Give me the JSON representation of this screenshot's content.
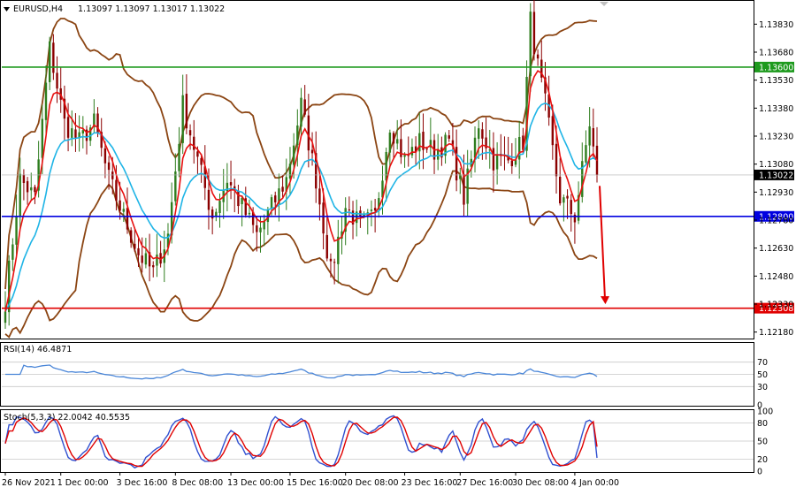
{
  "header": {
    "symbol": "EURUSD,H4",
    "ohlc": "1.13097 1.13097 1.13017 1.13022"
  },
  "colors": {
    "background": "#ffffff",
    "bull": "#2e7d1e",
    "bear": "#8b0000",
    "bollinger": "#8b4513",
    "ma_fast": "#e81010",
    "ma_slow": "#1eb4e6",
    "resistance": "#1e9a1e",
    "support": "#0000e0",
    "target": "#e00000",
    "rsi": "#4a86d8",
    "stoch_main": "#3050d0",
    "stoch_signal": "#e00000"
  },
  "chart_data": [
    {
      "type": "candlestick",
      "symbol": "EURUSD",
      "timeframe": "H4",
      "ylim": [
        1.1215,
        1.1395
      ],
      "y_ticks": [
        "1.13830",
        "1.13680",
        "1.13530",
        "1.13380",
        "1.13230",
        "1.13080",
        "1.12930",
        "1.12780",
        "1.12630",
        "1.12480",
        "1.12330",
        "1.12180"
      ],
      "x_ticks": [
        "26 Nov 2021",
        "1 Dec 00:00",
        "3 Dec 16:00",
        "8 Dec 08:00",
        "13 Dec 00:00",
        "15 Dec 16:00",
        "20 Dec 08:00",
        "23 Dec 16:00",
        "27 Dec 16:00",
        "30 Dec 08:00",
        "4 Jan 00:00"
      ],
      "close_anchors": [
        [
          0,
          1.1235
        ],
        [
          4,
          1.13
        ],
        [
          8,
          1.129
        ],
        [
          12,
          1.137
        ],
        [
          16,
          1.133
        ],
        [
          20,
          1.132
        ],
        [
          24,
          1.133
        ],
        [
          28,
          1.13
        ],
        [
          32,
          1.128
        ],
        [
          36,
          1.126
        ],
        [
          40,
          1.125
        ],
        [
          44,
          1.127
        ],
        [
          48,
          1.134
        ],
        [
          52,
          1.131
        ],
        [
          56,
          1.128
        ],
        [
          60,
          1.13
        ],
        [
          64,
          1.1285
        ],
        [
          68,
          1.127
        ],
        [
          72,
          1.1285
        ],
        [
          76,
          1.13
        ],
        [
          80,
          1.134
        ],
        [
          84,
          1.13
        ],
        [
          88,
          1.125
        ],
        [
          92,
          1.1285
        ],
        [
          96,
          1.1275
        ],
        [
          100,
          1.128
        ],
        [
          104,
          1.133
        ],
        [
          108,
          1.131
        ],
        [
          112,
          1.132
        ],
        [
          116,
          1.1315
        ],
        [
          120,
          1.132
        ],
        [
          124,
          1.129
        ],
        [
          128,
          1.133
        ],
        [
          132,
          1.131
        ],
        [
          136,
          1.131
        ],
        [
          140,
          1.132
        ],
        [
          142,
          1.1385
        ],
        [
          144,
          1.136
        ],
        [
          146,
          1.134
        ],
        [
          150,
          1.129
        ],
        [
          154,
          1.128
        ],
        [
          158,
          1.133
        ],
        [
          160,
          1.1302
        ]
      ],
      "horizontal_levels": [
        {
          "price": 1.136,
          "label": "1.13600",
          "color": "#1e9a1e"
        },
        {
          "price": 1.128,
          "label": "1.12800",
          "color": "#0000e0"
        },
        {
          "price": 1.12308,
          "label": "1.12308",
          "color": "#e00000"
        }
      ],
      "current_price": {
        "price": 1.13022,
        "label": "1.13022"
      },
      "projection_arrow": {
        "from_price": 1.1302,
        "to_price": 1.1232,
        "direction": "down"
      }
    },
    {
      "type": "line",
      "title": "RSI(14) 46.4871",
      "ylim": [
        0,
        100
      ],
      "y_ticks": [
        "70",
        "50",
        "30",
        "0"
      ],
      "levels": [
        70,
        50,
        30
      ],
      "current_value": 46.4871
    },
    {
      "type": "line",
      "title": "Stoch(5,3,3) 22.0042 40.5535",
      "ylim": [
        0,
        100
      ],
      "y_ticks": [
        "100",
        "80",
        "50",
        "20",
        "0"
      ],
      "levels": [
        80,
        50,
        20
      ],
      "main_value": 22.0042,
      "signal_value": 40.5535
    }
  ]
}
